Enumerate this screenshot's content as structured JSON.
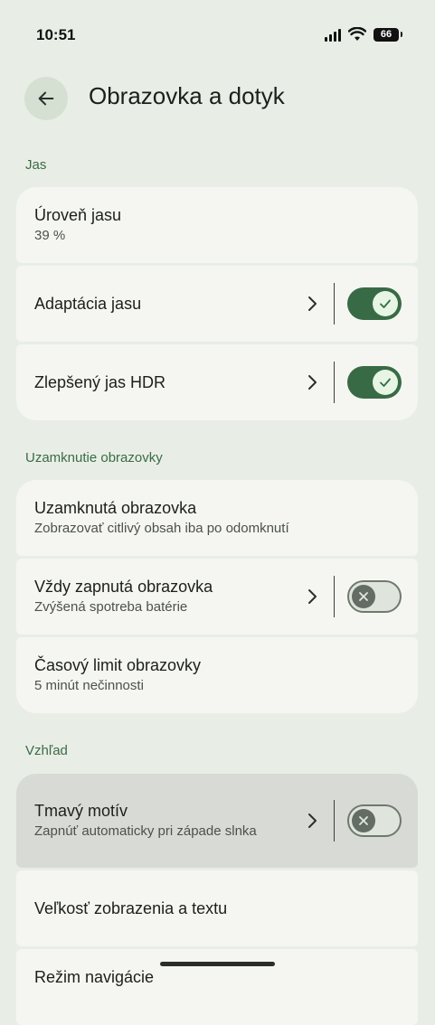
{
  "status_bar": {
    "time": "10:51",
    "battery": "66"
  },
  "header": {
    "title": "Obrazovka a dotyk"
  },
  "sections": [
    {
      "header": "Jas",
      "items": [
        {
          "title": "Úroveň jasu",
          "subtitle": "39 %"
        },
        {
          "title": "Adaptácia jasu",
          "toggle": "on"
        },
        {
          "title": "Zlepšený jas HDR",
          "toggle": "on"
        }
      ]
    },
    {
      "header": "Uzamknutie obrazovky",
      "items": [
        {
          "title": "Uzamknutá obrazovka",
          "subtitle": "Zobrazovať citlivý obsah iba po odomknutí"
        },
        {
          "title": "Vždy zapnutá obrazovka",
          "subtitle": "Zvýšená spotreba batérie",
          "toggle": "off"
        },
        {
          "title": "Časový limit obrazovky",
          "subtitle": "5 minút nečinnosti"
        }
      ]
    },
    {
      "header": "Vzhľad",
      "items": [
        {
          "title": "Tmavý motív",
          "subtitle": "Zapnúť automaticky pri západe slnka",
          "toggle": "off"
        },
        {
          "title": "Veľkosť zobrazenia a textu"
        },
        {
          "title": "Režim navigácie"
        }
      ]
    }
  ],
  "icons": {
    "back": "arrow-left-icon",
    "chevron": "chevron-right-icon",
    "check": "check-icon",
    "close": "close-icon",
    "signal": "signal-icon",
    "wifi": "wifi-icon",
    "battery": "battery-icon"
  },
  "colors": {
    "background": "#e8eee5",
    "card": "#f5f6f1",
    "accent": "#386b45",
    "section_header": "#3b6b47"
  }
}
